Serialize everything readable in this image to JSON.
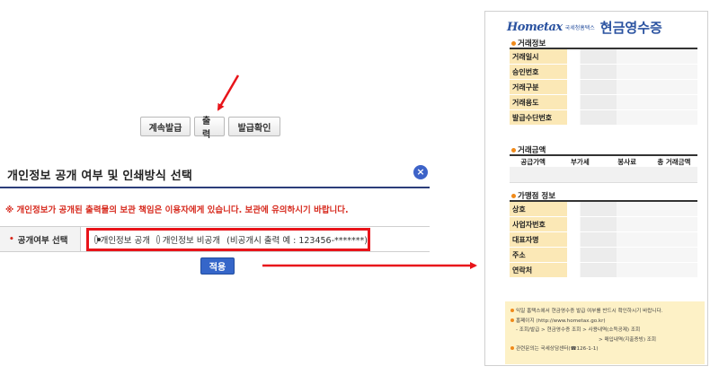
{
  "buttons": {
    "continue_issue": "계속발급",
    "print": "출력",
    "issue_check": "발급확인"
  },
  "dialog": {
    "title": "개인정보 공개 여부 및 인쇄방식 선택",
    "close_symbol": "×",
    "notice": "※ 개인정보가 공개된 출력물의 보관 책임은 이용자에게 있습니다. 보관에 유의하시기 바랍니다.",
    "field_label": "공개여부 선택",
    "option_public": "개인정보 공개",
    "option_private": "개인정보 비공개",
    "option_hint": "(비공개시 출력 예 : 123456-*******)",
    "selected": "public",
    "apply": "적용"
  },
  "receipt": {
    "logo": "Hometax",
    "logo_sub": "국세청홈택스",
    "title": "현금영수증",
    "section_trade": "거래정보",
    "trade_rows": [
      "거래일시",
      "승인번호",
      "거래구분",
      "거래용도",
      "발급수단번호"
    ],
    "section_amount": "거래금액",
    "amount_cols": [
      "공급가액",
      "부가세",
      "봉사료",
      "총 거래금액"
    ],
    "section_store": "가맹점 정보",
    "store_rows": [
      "상호",
      "사업자번호",
      "대표자명",
      "주소",
      "연락처"
    ],
    "notes": [
      "익일 홈택스에서 현금영수증 발급 여부를 반드시 확인하시기 바랍니다.",
      "홈페이지 (http://www.hometax.go.kr)",
      "- 조회/발급 > 현금영수증 조회 > 사용내역(소득공제) 조회",
      "> 매입내역(지출증빙) 조회",
      "관련문의는 국세상담센터(☎126-1-1)"
    ]
  },
  "colors": {
    "accent_red": "#e8141a",
    "button_blue": "#3566c9",
    "receipt_label_bg": "#fbe8b6",
    "note_bg": "#fdf1c6"
  }
}
